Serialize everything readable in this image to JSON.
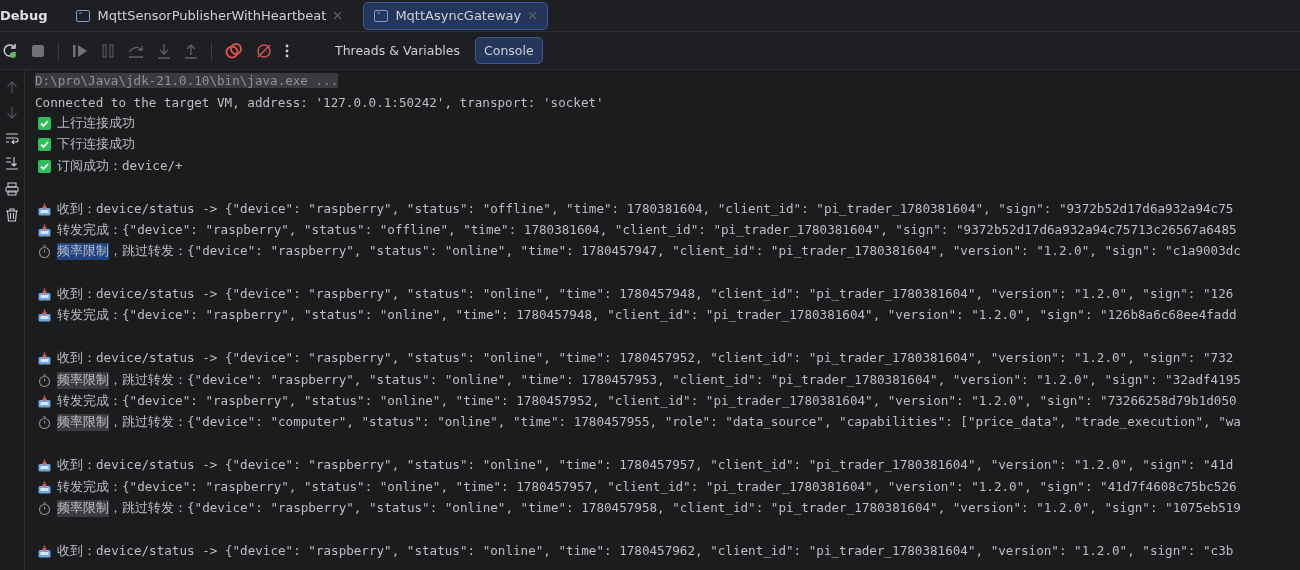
{
  "panel": {
    "title": "Debug"
  },
  "tabs": [
    {
      "label": "MqttSensorPublisherWithHeartbeat",
      "selected": false
    },
    {
      "label": "MqttAsyncGateway",
      "selected": true
    }
  ],
  "view_tabs": [
    {
      "label": "Threads & Variables",
      "selected": false
    },
    {
      "label": "Console",
      "selected": true
    }
  ],
  "console": [
    {
      "kind": "command",
      "text": "D:\\pro\\Java\\jdk-21.0.10\\bin\\java.exe ..."
    },
    {
      "kind": "plain",
      "text": "Connected to the target VM, address: '127.0.0.1:50242', transport: 'socket'"
    },
    {
      "kind": "ok",
      "text": "上行连接成功"
    },
    {
      "kind": "ok",
      "text": "下行连接成功"
    },
    {
      "kind": "ok",
      "text": "订阅成功：device/+"
    },
    {
      "kind": "blank"
    },
    {
      "kind": "received",
      "text": "收到：device/status -> {\"device\": \"raspberry\", \"status\": \"offline\", \"time\": 1780381604, \"client_id\": \"pi_trader_1780381604\", \"sign\": \"9372b52d17d6a932a94c75"
    },
    {
      "kind": "forwarded",
      "text": "转发完成：{\"device\": \"raspberry\", \"status\": \"offline\", \"time\": 1780381604, \"client_id\": \"pi_trader_1780381604\", \"sign\": \"9372b52d17d6a932a94c75713c26567a6485"
    },
    {
      "kind": "rate_limited",
      "tag": "频率限制",
      "selected": true,
      "text": "，跳过转发：{\"device\": \"raspberry\", \"status\": \"online\", \"time\": 1780457947, \"client_id\": \"pi_trader_1780381604\", \"version\": \"1.2.0\", \"sign\": \"c1a9003dc"
    },
    {
      "kind": "blank"
    },
    {
      "kind": "received",
      "text": "收到：device/status -> {\"device\": \"raspberry\", \"status\": \"online\", \"time\": 1780457948, \"client_id\": \"pi_trader_1780381604\", \"version\": \"1.2.0\", \"sign\": \"126"
    },
    {
      "kind": "forwarded",
      "text": "转发完成：{\"device\": \"raspberry\", \"status\": \"online\", \"time\": 1780457948, \"client_id\": \"pi_trader_1780381604\", \"version\": \"1.2.0\", \"sign\": \"126b8a6c68ee4fadd"
    },
    {
      "kind": "blank"
    },
    {
      "kind": "received",
      "text": "收到：device/status -> {\"device\": \"raspberry\", \"status\": \"online\", \"time\": 1780457952, \"client_id\": \"pi_trader_1780381604\", \"version\": \"1.2.0\", \"sign\": \"732"
    },
    {
      "kind": "rate_limited",
      "tag": "频率限制",
      "selected": false,
      "text": "，跳过转发：{\"device\": \"raspberry\", \"status\": \"online\", \"time\": 1780457953, \"client_id\": \"pi_trader_1780381604\", \"version\": \"1.2.0\", \"sign\": \"32adf4195"
    },
    {
      "kind": "forwarded",
      "text": "转发完成：{\"device\": \"raspberry\", \"status\": \"online\", \"time\": 1780457952, \"client_id\": \"pi_trader_1780381604\", \"version\": \"1.2.0\", \"sign\": \"73266258d79b1d050"
    },
    {
      "kind": "rate_limited",
      "tag": "频率限制",
      "selected": false,
      "text": "，跳过转发：{\"device\": \"computer\", \"status\": \"online\", \"time\": 1780457955, \"role\": \"data_source\", \"capabilities\": [\"price_data\", \"trade_execution\", \"wa"
    },
    {
      "kind": "blank"
    },
    {
      "kind": "received",
      "text": "收到：device/status -> {\"device\": \"raspberry\", \"status\": \"online\", \"time\": 1780457957, \"client_id\": \"pi_trader_1780381604\", \"version\": \"1.2.0\", \"sign\": \"41d"
    },
    {
      "kind": "forwarded",
      "text": "转发完成：{\"device\": \"raspberry\", \"status\": \"online\", \"time\": 1780457957, \"client_id\": \"pi_trader_1780381604\", \"version\": \"1.2.0\", \"sign\": \"41d7f4608c75bc526"
    },
    {
      "kind": "rate_limited",
      "tag": "频率限制",
      "selected": false,
      "text": "，跳过转发：{\"device\": \"raspberry\", \"status\": \"online\", \"time\": 1780457958, \"client_id\": \"pi_trader_1780381604\", \"version\": \"1.2.0\", \"sign\": \"1075eb519"
    },
    {
      "kind": "blank"
    },
    {
      "kind": "received",
      "text": "收到：device/status -> {\"device\": \"raspberry\", \"status\": \"online\", \"time\": 1780457962, \"client_id\": \"pi_trader_1780381604\", \"version\": \"1.2.0\", \"sign\": \"c3b"
    }
  ]
}
